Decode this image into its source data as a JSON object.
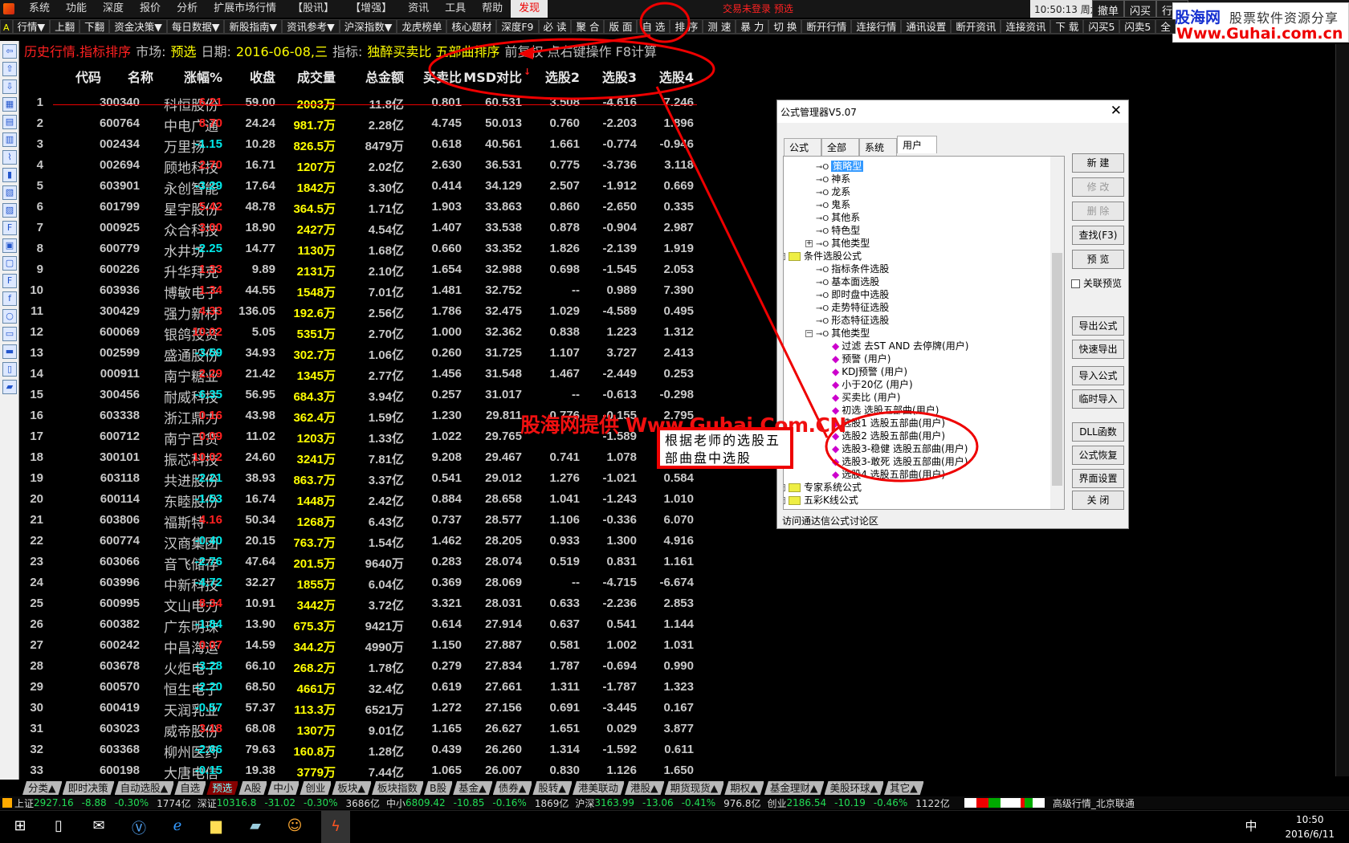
{
  "menu": {
    "items": [
      "系统",
      "功能",
      "深度",
      "报价",
      "分析",
      "扩展市场行情",
      "【股讯】",
      "【增强】",
      "资讯",
      "工具",
      "帮助",
      "发现"
    ],
    "active": "发现"
  },
  "trade_status": "交易未登录   预选",
  "clock": "10:50:13 周六",
  "quick_buttons": [
    "撤单",
    "闪买",
    "行情"
  ],
  "logo": {
    "line1": "股海网",
    "line1b": "股票软件资源分享",
    "line2": "Www.Guhai.com.cn"
  },
  "toolbar": {
    "items": [
      "行情▼",
      "上翻",
      "下翻",
      "资金决策▼",
      "每日数据▼",
      "新股指南▼",
      "资讯参考▼",
      "沪深指数▼",
      "龙虎榜单",
      "核心题材",
      "深度F9",
      "必 读",
      "聚 合",
      "版 面",
      "自 选",
      "排 序",
      "测 速",
      "暴 力",
      "切 换",
      "断开行情",
      "连接行情",
      "通讯设置",
      "断开资讯",
      "连接资讯",
      "下 载",
      "闪买5",
      "闪卖5",
      "全"
    ]
  },
  "header": {
    "title": "历史行情.指标排序",
    "market_label": "市场:",
    "market": "预选",
    "date_label": "日期:",
    "date": "2016-06-08,三",
    "indicator_label": "指标:",
    "indicator": "独醉买卖比 五部曲排序",
    "hint": "前复权 点右键操作 F8计算"
  },
  "table": {
    "columns": [
      "代码",
      "名称",
      "涨幅%",
      "收盘",
      "成交量",
      "总金额",
      "买卖比",
      "MSD对比",
      "选股2",
      "选股3",
      "选股4"
    ],
    "sort_indicator": "↓",
    "rows": [
      [
        "1",
        "300340",
        "科恒股份",
        "6.21",
        "59.00",
        "2003万",
        "11.8亿",
        "0.801",
        "60.531",
        "3.508",
        "-4.616",
        "7.246"
      ],
      [
        "2",
        "600764",
        "中电广通",
        "8.70",
        "24.24",
        "981.7万",
        "2.28亿",
        "4.745",
        "50.013",
        "0.760",
        "-2.203",
        "1.896"
      ],
      [
        "3",
        "002434",
        "万里扬",
        "-1.15",
        "10.28",
        "826.5万",
        "8479万",
        "0.618",
        "40.561",
        "1.661",
        "-0.774",
        "-0.946"
      ],
      [
        "4",
        "002694",
        "顾地科技",
        "2.70",
        "16.71",
        "1207万",
        "2.02亿",
        "2.630",
        "36.531",
        "0.775",
        "-3.736",
        "3.118"
      ],
      [
        "5",
        "603901",
        "永创智能",
        "-3.29",
        "17.64",
        "1842万",
        "3.30亿",
        "0.414",
        "34.129",
        "2.507",
        "-1.912",
        "0.669"
      ],
      [
        "6",
        "601799",
        "星宇股份",
        "5.42",
        "48.78",
        "364.5万",
        "1.71亿",
        "1.903",
        "33.863",
        "0.860",
        "-2.650",
        "0.335"
      ],
      [
        "7",
        "000925",
        "众合科技",
        "3.00",
        "18.90",
        "2427万",
        "4.54亿",
        "1.407",
        "33.538",
        "0.878",
        "-0.904",
        "2.987"
      ],
      [
        "8",
        "600779",
        "水井坊",
        "-2.25",
        "14.77",
        "1130万",
        "1.68亿",
        "0.660",
        "33.352",
        "1.826",
        "-2.139",
        "1.919"
      ],
      [
        "9",
        "600226",
        "升华拜克",
        "1.33",
        "9.89",
        "2131万",
        "2.10亿",
        "1.654",
        "32.988",
        "0.698",
        "-1.545",
        "2.053"
      ],
      [
        "10",
        "603936",
        "博敏电子",
        "1.34",
        "44.55",
        "1548万",
        "7.01亿",
        "1.481",
        "32.752",
        "--",
        "0.989",
        "7.390"
      ],
      [
        "11",
        "300429",
        "强力新材",
        "4.33",
        "136.05",
        "192.6万",
        "2.56亿",
        "1.786",
        "32.475",
        "1.029",
        "-4.589",
        "0.495"
      ],
      [
        "12",
        "600069",
        "银鸽投资",
        "10.02",
        "5.05",
        "5351万",
        "2.70亿",
        "1.000",
        "32.362",
        "0.838",
        "1.223",
        "1.312"
      ],
      [
        "13",
        "002599",
        "盛通股份",
        "-3.59",
        "34.93",
        "302.7万",
        "1.06亿",
        "0.260",
        "31.725",
        "1.107",
        "3.727",
        "2.413"
      ],
      [
        "14",
        "000911",
        "南宁糖业",
        "2.29",
        "21.42",
        "1345万",
        "2.77亿",
        "1.456",
        "31.548",
        "1.467",
        "-2.449",
        "0.253"
      ],
      [
        "15",
        "300456",
        "耐威科技",
        "-6.35",
        "56.95",
        "684.3万",
        "3.94亿",
        "0.257",
        "31.017",
        "--",
        "-0.613",
        "-0.298"
      ],
      [
        "16",
        "603338",
        "浙江鼎力",
        "0.16",
        "43.98",
        "362.4万",
        "1.59亿",
        "1.230",
        "29.811",
        "0.776",
        "-0.155",
        "2.795"
      ],
      [
        "17",
        "600712",
        "南宁百货",
        "0.09",
        "11.02",
        "1203万",
        "1.33亿",
        "1.022",
        "29.765",
        "",
        "-1.589",
        ""
      ],
      [
        "18",
        "300101",
        "振芯科技",
        "10.02",
        "24.60",
        "3241万",
        "7.81亿",
        "9.208",
        "29.467",
        "0.741",
        "1.078",
        ""
      ],
      [
        "19",
        "603118",
        "共进股份",
        "-2.21",
        "38.93",
        "863.7万",
        "3.37亿",
        "0.541",
        "29.012",
        "1.276",
        "-1.021",
        "0.584"
      ],
      [
        "20",
        "600114",
        "东睦股份",
        "-1.53",
        "16.74",
        "1448万",
        "2.42亿",
        "0.884",
        "28.658",
        "1.041",
        "-1.243",
        "1.010"
      ],
      [
        "21",
        "603806",
        "福斯特",
        "4.16",
        "50.34",
        "1268万",
        "6.43亿",
        "0.737",
        "28.577",
        "1.106",
        "-0.336",
        "6.070"
      ],
      [
        "22",
        "600774",
        "汉商集团",
        "-0.40",
        "20.15",
        "763.7万",
        "1.54亿",
        "1.462",
        "28.205",
        "0.933",
        "1.300",
        "4.916"
      ],
      [
        "23",
        "603066",
        "音飞储存",
        "-2.76",
        "47.64",
        "201.5万",
        "9640万",
        "0.283",
        "28.074",
        "0.519",
        "0.831",
        "1.161"
      ],
      [
        "24",
        "603996",
        "中新科技",
        "-4.72",
        "32.27",
        "1855万",
        "6.04亿",
        "0.369",
        "28.069",
        "--",
        "-4.715",
        "-6.674"
      ],
      [
        "25",
        "600995",
        "文山电力",
        "8.34",
        "10.91",
        "3442万",
        "3.72亿",
        "3.321",
        "28.031",
        "0.633",
        "-2.236",
        "2.853"
      ],
      [
        "26",
        "600382",
        "广东明珠",
        "-1.84",
        "13.90",
        "675.3万",
        "9421万",
        "0.614",
        "27.914",
        "0.637",
        "0.541",
        "1.144"
      ],
      [
        "27",
        "600242",
        "中昌海运",
        "0.07",
        "14.59",
        "344.2万",
        "4990万",
        "1.150",
        "27.887",
        "0.581",
        "1.002",
        "1.031"
      ],
      [
        "28",
        "603678",
        "火炬电子",
        "-3.28",
        "66.10",
        "268.2万",
        "1.78亿",
        "0.279",
        "27.834",
        "1.787",
        "-0.694",
        "0.990"
      ],
      [
        "29",
        "600570",
        "恒生电子",
        "-2.20",
        "68.50",
        "4661万",
        "32.4亿",
        "0.619",
        "27.661",
        "1.311",
        "-1.787",
        "1.323"
      ],
      [
        "30",
        "600419",
        "天润乳业",
        "-0.57",
        "57.37",
        "113.3万",
        "6521万",
        "1.272",
        "27.156",
        "0.691",
        "-3.445",
        "0.167"
      ],
      [
        "31",
        "603023",
        "威帝股份",
        "3.18",
        "68.08",
        "1307万",
        "9.01亿",
        "1.165",
        "26.627",
        "1.651",
        "0.029",
        "3.877"
      ],
      [
        "32",
        "603368",
        "柳州医药",
        "-2.66",
        "79.63",
        "160.8万",
        "1.28亿",
        "0.439",
        "26.260",
        "1.314",
        "-1.592",
        "0.611"
      ],
      [
        "33",
        "600198",
        "大唐电信",
        "-0.15",
        "19.38",
        "3779万",
        "7.44亿",
        "1.065",
        "26.007",
        "0.830",
        "1.126",
        "1.650"
      ]
    ]
  },
  "dialog": {
    "title": "公式管理器V5.07",
    "tabs": [
      "公式组",
      "全部",
      "系统",
      "用户"
    ],
    "active_tab": "用户",
    "tree": [
      {
        "level": 2,
        "icon": "key",
        "text": "策略型",
        "selected": true
      },
      {
        "level": 2,
        "icon": "key",
        "text": "神系"
      },
      {
        "level": 2,
        "icon": "key",
        "text": "龙系"
      },
      {
        "level": 2,
        "icon": "key",
        "text": "鬼系"
      },
      {
        "level": 2,
        "icon": "key",
        "text": "其他系"
      },
      {
        "level": 2,
        "icon": "key",
        "text": "特色型"
      },
      {
        "level": 2,
        "icon": "key",
        "text": "其他类型",
        "expander": "+"
      },
      {
        "level": 0,
        "icon": "folder",
        "text": "条件选股公式",
        "expander": "-"
      },
      {
        "level": 2,
        "icon": "key",
        "text": "指标条件选股"
      },
      {
        "level": 2,
        "icon": "key",
        "text": "基本面选股"
      },
      {
        "level": 2,
        "icon": "key",
        "text": "即时盘中选股"
      },
      {
        "level": 2,
        "icon": "key",
        "text": "走势特征选股"
      },
      {
        "level": 2,
        "icon": "key",
        "text": "形态特征选股"
      },
      {
        "level": 2,
        "icon": "key",
        "text": "其他类型",
        "expander": "-"
      },
      {
        "level": 3,
        "icon": "diamond",
        "text": "过滤   去ST AND 去停牌(用户)"
      },
      {
        "level": 3,
        "icon": "diamond",
        "text": "预警  (用户)"
      },
      {
        "level": 3,
        "icon": "diamond",
        "text": "KDJ预警  (用户)"
      },
      {
        "level": 3,
        "icon": "diamond",
        "text": "小于20亿  (用户)"
      },
      {
        "level": 3,
        "icon": "diamond",
        "text": "买卖比  (用户)"
      },
      {
        "level": 3,
        "icon": "diamond",
        "text": "初选  选股五部曲(用户)"
      },
      {
        "level": 3,
        "icon": "diamond",
        "text": "选股1  选股五部曲(用户)"
      },
      {
        "level": 3,
        "icon": "diamond",
        "text": "选股2  选股五部曲(用户)"
      },
      {
        "level": 3,
        "icon": "diamond",
        "text": "选股3-稳健  选股五部曲(用户)"
      },
      {
        "level": 3,
        "icon": "diamond",
        "text": "选股3-敢死  选股五部曲(用户)"
      },
      {
        "level": 3,
        "icon": "diamond",
        "text": "选股4  选股五部曲(用户)"
      },
      {
        "level": 0,
        "icon": "folder",
        "text": "专家系统公式",
        "expander": "+"
      },
      {
        "level": 0,
        "icon": "folder",
        "text": "五彩K线公式",
        "expander": "+"
      }
    ],
    "buttons": [
      {
        "label": "新  建",
        "disabled": false
      },
      {
        "label": "修  改",
        "disabled": true
      },
      {
        "label": "删  除",
        "disabled": true
      },
      {
        "label": "查找(F3)",
        "disabled": false
      },
      {
        "label": "预  览",
        "disabled": false
      },
      {
        "label": "导出公式",
        "disabled": false
      },
      {
        "label": "快速导出",
        "disabled": false
      },
      {
        "label": "导入公式",
        "disabled": false
      },
      {
        "label": "临时导入",
        "disabled": false
      },
      {
        "label": "DLL函数",
        "disabled": false
      },
      {
        "label": "公式恢复",
        "disabled": false
      },
      {
        "label": "界面设置",
        "disabled": false
      },
      {
        "label": "关  闭",
        "disabled": false
      }
    ],
    "checkbox": {
      "label": "关联预览",
      "checked": false
    },
    "footer_link": "访问通达信公式讨论区"
  },
  "bottom_tabs": {
    "items": [
      "分类▲",
      "即时决策",
      "自动选股▲",
      "自选",
      "预选",
      "A股",
      "中小",
      "创业",
      "板块▲",
      "板块指数",
      "B股",
      "基金▲",
      "债券▲",
      "股转▲",
      "港美联动",
      "港股▲",
      "期货现货▲",
      "期权▲",
      "基金理财▲",
      "美股环球▲",
      "其它▲"
    ],
    "active": "预选"
  },
  "status": {
    "indices": [
      {
        "name": "上证",
        "value": "2927.16",
        "change": "-8.88",
        "pct": "-0.30%",
        "amount": "1774亿"
      },
      {
        "name": "深证",
        "value": "10316.8",
        "change": "-31.02",
        "pct": "-0.30%",
        "amount": "3686亿"
      },
      {
        "name": "中小",
        "value": "6809.42",
        "change": "-10.85",
        "pct": "-0.16%",
        "amount": "1869亿"
      },
      {
        "name": "沪深",
        "value": "3163.99",
        "change": "-13.06",
        "pct": "-0.41%",
        "amount": "976.8亿"
      },
      {
        "name": "创业",
        "value": "2186.54",
        "change": "-10.19",
        "pct": "-0.46%",
        "amount": "1122亿"
      }
    ],
    "server": "高级行情_北京联通"
  },
  "taskbar": {
    "time": "10:50",
    "date": "2016/6/11",
    "ime": "中"
  },
  "annotations": {
    "watermark": "股海网提供 Www.Guhai.Com.CN",
    "callout": "根据老师的选股五部曲盘中选股",
    "color": "#ee0000"
  },
  "colors": {
    "up": "#ff2020",
    "down": "#00e8e8",
    "volume": "#ffff00",
    "neutral": "#c8c8c8",
    "background": "#000000"
  }
}
